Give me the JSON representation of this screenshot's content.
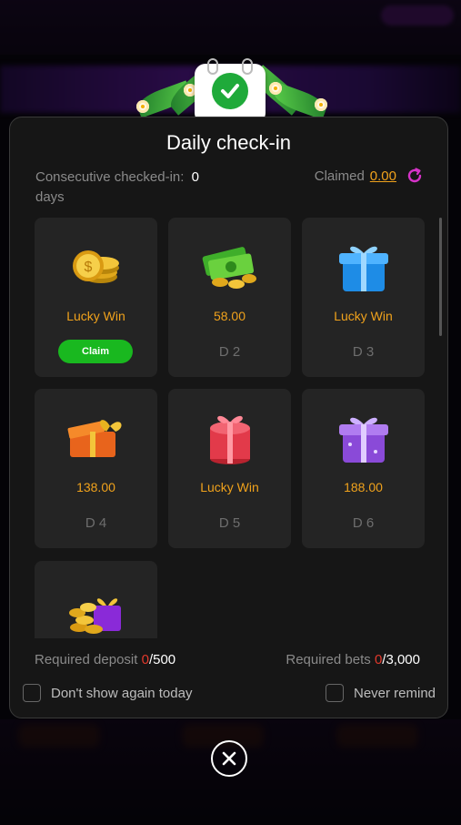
{
  "modal": {
    "title": "Daily check-in",
    "consecutive_label": "Consecutive checked-in:",
    "consecutive_value": "0",
    "consecutive_unit": "days",
    "claimed_label": "Claimed",
    "claimed_value": "0.00"
  },
  "rewards": [
    {
      "label": "Lucky Win",
      "action": "Claim",
      "icon": "gold-coins-icon"
    },
    {
      "label": "58.00",
      "day": "D 2",
      "icon": "cash-and-coins-icon"
    },
    {
      "label": "Lucky Win",
      "day": "D 3",
      "icon": "blue-gift-icon"
    },
    {
      "label": "138.00",
      "day": "D 4",
      "icon": "orange-gift-box-icon"
    },
    {
      "label": "Lucky Win",
      "day": "D 5",
      "icon": "red-gift-icon"
    },
    {
      "label": "188.00",
      "day": "D 6",
      "icon": "purple-gift-icon"
    },
    {
      "icon": "treasure-coins-gift-icon"
    }
  ],
  "requirements": {
    "deposit_label": "Required deposit",
    "deposit_current": "0",
    "deposit_total": "/500",
    "bets_label": "Required bets",
    "bets_current": "0",
    "bets_total": "/3,000"
  },
  "options": {
    "dont_show_today": "Don't show again today",
    "never_remind": "Never remind"
  },
  "colors": {
    "accent": "#f0a21c",
    "claim_green": "#19b81f",
    "required_red": "#e2392c",
    "panel": "#161616",
    "card": "#242424"
  }
}
